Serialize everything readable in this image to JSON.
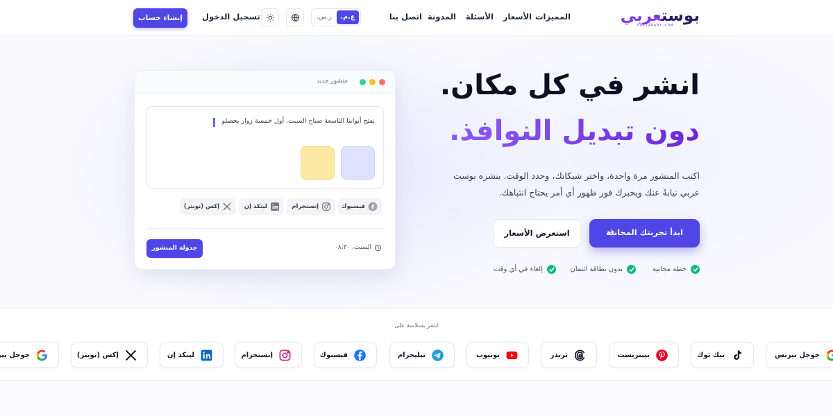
{
  "brand": {
    "name_part1": "بوست",
    "name_part2": "عربي",
    "tagline": "POSTARABY.COM"
  },
  "nav": {
    "links": [
      "المميزات",
      "الأسعار",
      "الأسئلة",
      "المدونة",
      "اتصل بنا"
    ],
    "language": {
      "active": "ع.م.",
      "inactive": "ر.س."
    },
    "login_label": "تسجيل الدخول",
    "signup_label": "إنشاء حساب"
  },
  "hero": {
    "headline_line1": "انشر في كل مكان.",
    "headline_line2": "دون تبديل النوافذ.",
    "description": "اكتب المنشور مرة واحدة، واختر شبكاتك، وحدد الوقت. ينشره بوست عربي نيابةً عنك ويخبرك فور ظهور أي أمر يحتاج انتباهك.",
    "primary_cta": "ابدأ تجربتك المجانية",
    "secondary_cta": "استعرض الأسعار",
    "features": [
      "خطة مجانية",
      "بدون بطاقة ائتمان",
      "إلغاء في أي وقت"
    ]
  },
  "composer": {
    "title": "منشور جديد",
    "post_text": "نفتح أبوابنا التاسعة صباح السبت. أول خمسة زوار يحصلو",
    "chips": [
      {
        "label": "فيسبوك",
        "icon": "facebook-icon"
      },
      {
        "label": "إنستجرام",
        "icon": "instagram-icon"
      },
      {
        "label": "لينكد إن",
        "icon": "linkedin-icon"
      },
      {
        "label": "إكس (تويتر)",
        "icon": "x-icon"
      }
    ],
    "time": "السبت، ٠٨:٣٠",
    "schedule_label": "جدولة المنشور"
  },
  "platforms": {
    "title": "انشر بسلاسة على",
    "items": [
      {
        "label": "جوجل بيزنس",
        "icon": "google-icon"
      },
      {
        "label": "تيك توك",
        "icon": "tiktok-icon"
      },
      {
        "label": "بينتريست",
        "icon": "pinterest-icon"
      },
      {
        "label": "ثريدز",
        "icon": "threads-icon"
      },
      {
        "label": "يوتيوب",
        "icon": "youtube-icon"
      },
      {
        "label": "تيليجرام",
        "icon": "telegram-icon"
      },
      {
        "label": "فيسبوك",
        "icon": "facebook-icon"
      },
      {
        "label": "إنستجرام",
        "icon": "instagram-icon"
      },
      {
        "label": "لينكد إن",
        "icon": "linkedin-icon"
      },
      {
        "label": "إكس (تويتر)",
        "icon": "x-icon"
      },
      {
        "label": "جوجل بيزنس",
        "icon": "google-icon"
      }
    ]
  },
  "colors": {
    "primary": "#4f46e5",
    "accent_purple": "#7c3aed",
    "success": "#10b981"
  }
}
